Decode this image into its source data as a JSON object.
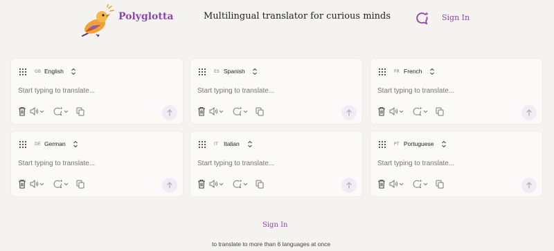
{
  "brand": {
    "name": "Polyglotta",
    "tagline": "Multilingual translator for curious minds",
    "accent": "#8e44ad"
  },
  "header": {
    "signin_label": "Sign In",
    "history_icon": "chat-sparkle-icon"
  },
  "cards": [
    {
      "code": "GB",
      "language": "English",
      "placeholder": "Start typing to translate..."
    },
    {
      "code": "ES",
      "language": "Spanish",
      "placeholder": "Start typing to translate..."
    },
    {
      "code": "FR",
      "language": "French",
      "placeholder": "Start typing to translate..."
    },
    {
      "code": "DE",
      "language": "German",
      "placeholder": "Start typing to translate..."
    },
    {
      "code": "IT",
      "language": "Italian",
      "placeholder": "Start typing to translate..."
    },
    {
      "code": "PT",
      "language": "Portuguese",
      "placeholder": "Start typing to translate..."
    }
  ],
  "card_tools": [
    "trash-icon",
    "speaker-icon",
    "chevron-down-icon",
    "sparkle-bubble-icon",
    "chevron-down-icon",
    "copy-icon",
    "arrow-up-icon"
  ],
  "footer": {
    "signin_label": "Sign In",
    "note": "to translate to more than 6 languages at once"
  }
}
